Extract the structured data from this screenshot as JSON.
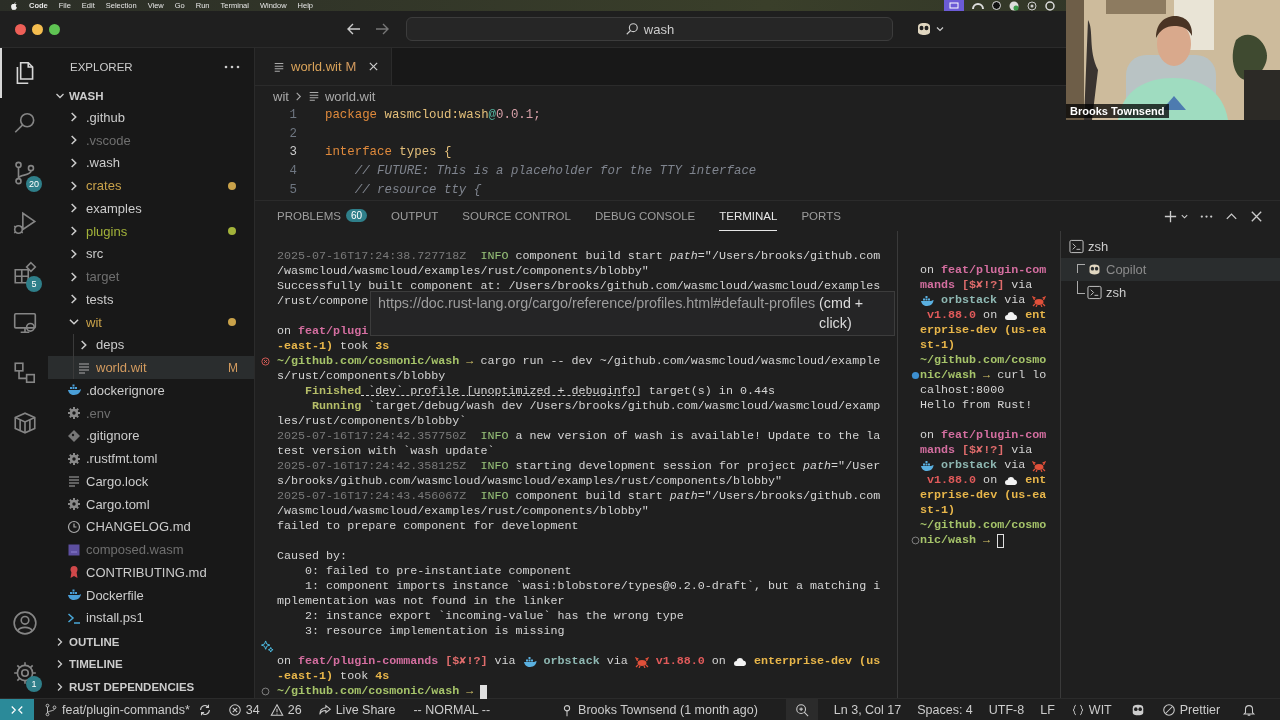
{
  "menu_bar": {
    "app": "Code",
    "items": [
      "File",
      "Edit",
      "Selection",
      "View",
      "Go",
      "Run",
      "Terminal",
      "Window",
      "Help"
    ]
  },
  "title_bar": {
    "search": {
      "value": "wash"
    }
  },
  "activity_bar": {
    "items": [
      {
        "kind": "explorer",
        "selected": true
      },
      {
        "kind": "search",
        "selected": false
      },
      {
        "kind": "source-control",
        "selected": false,
        "badge": "20"
      },
      {
        "kind": "run-debug",
        "selected": false
      },
      {
        "kind": "extensions",
        "selected": false,
        "badge": "5"
      },
      {
        "kind": "remote",
        "selected": false
      },
      {
        "kind": "graph",
        "selected": false
      },
      {
        "kind": "containers",
        "selected": false
      }
    ],
    "bottom": [
      {
        "kind": "account"
      },
      {
        "kind": "settings",
        "badge": "1"
      }
    ]
  },
  "explorer": {
    "title": "EXPLORER",
    "root": {
      "label": "WASH",
      "expanded": true,
      "children": [
        {
          "label": ".github",
          "kind": "folder",
          "expanded": false,
          "color": "#cccccc",
          "dot": false,
          "selected": false
        },
        {
          "label": ".vscode",
          "kind": "folder",
          "expanded": false,
          "color": "#6f6f6f",
          "dot": false,
          "selected": false
        },
        {
          "label": ".wash",
          "kind": "folder",
          "expanded": false,
          "color": "#cccccc",
          "dot": false,
          "selected": false
        },
        {
          "label": "crates",
          "kind": "folder",
          "expanded": false,
          "color": "#c9a24a",
          "dot": true,
          "selected": false
        },
        {
          "label": "examples",
          "kind": "folder",
          "expanded": false,
          "color": "#cccccc",
          "dot": false,
          "selected": false
        },
        {
          "label": "plugins",
          "kind": "folder",
          "expanded": false,
          "color": "#a3b33a",
          "dot": true,
          "selected": false
        },
        {
          "label": "src",
          "kind": "folder",
          "expanded": false,
          "color": "#cccccc",
          "dot": false,
          "selected": false
        },
        {
          "label": "target",
          "kind": "folder",
          "expanded": false,
          "color": "#6f6f6f",
          "dot": false,
          "selected": false
        },
        {
          "label": "tests",
          "kind": "folder",
          "expanded": false,
          "color": "#cccccc",
          "dot": false,
          "selected": false
        },
        {
          "label": "wit",
          "kind": "folder",
          "expanded": true,
          "color": "#c9a24a",
          "dot": true,
          "selected": false,
          "children": [
            {
              "label": "deps",
              "kind": "folder",
              "expanded": false,
              "color": "#cccccc",
              "dot": false,
              "selected": false
            },
            {
              "label": "world.wit",
              "kind": "text-file",
              "color": "#d39b5f",
              "dot": false,
              "badge": "M",
              "selected": true
            }
          ]
        },
        {
          "label": ".dockerignore",
          "kind": "docker-file",
          "color": "#cccccc",
          "dot": false,
          "selected": false
        },
        {
          "label": ".env",
          "kind": "config-file",
          "color": "#6f6f6f",
          "dot": false,
          "selected": false
        },
        {
          "label": ".gitignore",
          "kind": "git-file",
          "color": "#cccccc",
          "dot": false,
          "selected": false
        },
        {
          "label": ".rustfmt.toml",
          "kind": "config-file",
          "color": "#cccccc",
          "dot": false,
          "selected": false
        },
        {
          "label": "Cargo.lock",
          "kind": "text-file",
          "color": "#cccccc",
          "dot": false,
          "selected": false
        },
        {
          "label": "Cargo.toml",
          "kind": "config-file",
          "color": "#cccccc",
          "dot": false,
          "selected": false
        },
        {
          "label": "CHANGELOG.md",
          "kind": "changelog-file",
          "color": "#cccccc",
          "dot": false,
          "selected": false
        },
        {
          "label": "composed.wasm",
          "kind": "wasm-file",
          "color": "#6f6f6f",
          "dot": false,
          "selected": false
        },
        {
          "label": "CONTRIBUTING.md",
          "kind": "contributing-file",
          "color": "#cccccc",
          "dot": false,
          "selected": false
        },
        {
          "label": "Dockerfile",
          "kind": "docker-file",
          "color": "#cccccc",
          "dot": false,
          "selected": false
        },
        {
          "label": "install.ps1",
          "kind": "shell-file",
          "color": "#cccccc",
          "dot": false,
          "selected": false
        }
      ]
    },
    "sections": [
      {
        "label": "OUTLINE",
        "expanded": false
      },
      {
        "label": "TIMELINE",
        "expanded": false
      },
      {
        "label": "RUST DEPENDENCIES",
        "expanded": false
      }
    ]
  },
  "editor": {
    "tabs": [
      {
        "label": "world.wit",
        "badge": "M",
        "selected": true
      }
    ],
    "breadcrumb": [
      "wit",
      "world.wit"
    ],
    "lines": [
      {
        "number": "1",
        "current": false,
        "segments": [
          {
            "kind": "keyword",
            "text": "package "
          },
          {
            "kind": "name",
            "text": "wasmcloud:wash"
          },
          {
            "kind": "at",
            "text": "@"
          },
          {
            "kind": "number",
            "text": "0.0.1;"
          }
        ]
      },
      {
        "number": "2",
        "current": false
      },
      {
        "number": "3",
        "current": true,
        "segments": [
          {
            "kind": "keyword",
            "text": "interface "
          },
          {
            "kind": "name",
            "text": "types {"
          }
        ]
      },
      {
        "number": "4",
        "current": false,
        "segments": [
          {
            "kind": "comment",
            "text": "    // FUTURE: This is a placeholder for the TTY interface"
          }
        ]
      },
      {
        "number": "5",
        "current": false,
        "segments": [
          {
            "kind": "comment",
            "text": "    // resource tty {"
          }
        ]
      }
    ]
  },
  "panel": {
    "tabs": [
      {
        "label": "PROBLEMS",
        "badge": "60",
        "selected": false
      },
      {
        "label": "OUTPUT",
        "selected": false
      },
      {
        "label": "SOURCE CONTROL",
        "selected": false
      },
      {
        "label": "DEBUG CONSOLE",
        "selected": false
      },
      {
        "label": "TERMINAL",
        "selected": true
      },
      {
        "label": "PORTS",
        "selected": false
      }
    ]
  },
  "terminal": {
    "tooltip": {
      "link": "https://doc.rust-lang.org/cargo/reference/profiles.html#default-profiles",
      "hint": "(cmd + click)"
    },
    "panes": [
      {
        "focused": true,
        "lines": [
          {
            "kind": "output",
            "segments": [
              {
                "kind": "dim",
                "text": "2025-07-16T17:24:38.727718Z  "
              },
              {
                "kind": "info",
                "text": "INFO"
              },
              {
                "kind": "plain",
                "text": " component build start "
              },
              {
                "kind": "italic",
                "text": "path"
              },
              {
                "kind": "plain",
                "text": "=\"/Users/brooks/github.com"
              }
            ]
          },
          {
            "kind": "output",
            "segments": [
              {
                "kind": "plain",
                "text": "/wasmcloud/wasmcloud/examples/rust/components/blobby\""
              }
            ]
          },
          {
            "kind": "output",
            "segments": [
              {
                "kind": "plain",
                "text": "Successfully built component at: /Users/brooks/github.com/wasmcloud/wasmcloud/examples"
              }
            ]
          },
          {
            "kind": "output",
            "segments": [
              {
                "kind": "plain",
                "text": "/rust/compone"
              }
            ]
          },
          {
            "kind": "blank"
          },
          {
            "kind": "output",
            "segments": [
              {
                "kind": "plain",
                "text": "on "
              },
              {
                "kind": "branch",
                "text": "feat/plugi"
              }
            ]
          },
          {
            "kind": "output",
            "segments": [
              {
                "kind": "context",
                "text": "-east-1)"
              },
              {
                "kind": "plain",
                "text": " took "
              },
              {
                "kind": "context",
                "text": "3s"
              }
            ]
          },
          {
            "kind": "output",
            "decoration": {
              "kind": "error"
            },
            "segments": [
              {
                "kind": "path",
                "text": "~/github.com/cosmonic/wash"
              },
              {
                "kind": "arrow",
                "text": " → "
              },
              {
                "kind": "plain",
                "text": "cargo run -- dev ~/github.com/wasmcloud/wasmcloud/example"
              }
            ]
          },
          {
            "kind": "output",
            "segments": [
              {
                "kind": "plain",
                "text": "s/rust/components/blobby"
              }
            ]
          },
          {
            "kind": "output",
            "segments": [
              {
                "kind": "cargo",
                "text": "    Finished"
              },
              {
                "kind": "link",
                "text": " `dev` profile [unoptimized + debuginfo]"
              },
              {
                "kind": "plain",
                "text": " target(s) in 0.44s"
              }
            ]
          },
          {
            "kind": "output",
            "segments": [
              {
                "kind": "cargo",
                "text": "     Running"
              },
              {
                "kind": "plain",
                "text": " `target/debug/wash dev /Users/brooks/github.com/wasmcloud/wasmcloud/examp"
              }
            ]
          },
          {
            "kind": "output",
            "segments": [
              {
                "kind": "plain",
                "text": "les/rust/components/blobby`"
              }
            ]
          },
          {
            "kind": "output",
            "segments": [
              {
                "kind": "dim",
                "text": "2025-07-16T17:24:42.357750Z  "
              },
              {
                "kind": "info",
                "text": "INFO"
              },
              {
                "kind": "plain",
                "text": " a new version of wash is available! Update to the la"
              }
            ]
          },
          {
            "kind": "output",
            "segments": [
              {
                "kind": "plain",
                "text": "test version with `wash update`"
              }
            ]
          },
          {
            "kind": "output",
            "segments": [
              {
                "kind": "dim",
                "text": "2025-07-16T17:24:42.358125Z  "
              },
              {
                "kind": "info",
                "text": "INFO"
              },
              {
                "kind": "plain",
                "text": " starting development session for project "
              },
              {
                "kind": "italic",
                "text": "path"
              },
              {
                "kind": "plain",
                "text": "=\"/User"
              }
            ]
          },
          {
            "kind": "output",
            "segments": [
              {
                "kind": "plain",
                "text": "s/brooks/github.com/wasmcloud/wasmcloud/examples/rust/components/blobby\""
              }
            ]
          },
          {
            "kind": "output",
            "segments": [
              {
                "kind": "dim",
                "text": "2025-07-16T17:24:43.456067Z  "
              },
              {
                "kind": "info",
                "text": "INFO"
              },
              {
                "kind": "plain",
                "text": " component build start "
              },
              {
                "kind": "italic",
                "text": "path"
              },
              {
                "kind": "plain",
                "text": "=\"/Users/brooks/github.com"
              }
            ]
          },
          {
            "kind": "output",
            "segments": [
              {
                "kind": "plain",
                "text": "/wasmcloud/wasmcloud/examples/rust/components/blobby\""
              }
            ]
          },
          {
            "kind": "output",
            "segments": [
              {
                "kind": "plain",
                "text": "failed to prepare component for development"
              }
            ]
          },
          {
            "kind": "blank"
          },
          {
            "kind": "output",
            "segments": [
              {
                "kind": "plain",
                "text": "Caused by:"
              }
            ]
          },
          {
            "kind": "output",
            "segments": [
              {
                "kind": "plain",
                "text": "    0: failed to pre-instantiate component"
              }
            ]
          },
          {
            "kind": "output",
            "segments": [
              {
                "kind": "plain",
                "text": "    1: component imports instance `wasi:blobstore/types@0.2.0-draft`, but a matching i"
              }
            ]
          },
          {
            "kind": "output",
            "segments": [
              {
                "kind": "plain",
                "text": "mplementation was not found in the linker"
              }
            ]
          },
          {
            "kind": "output",
            "segments": [
              {
                "kind": "plain",
                "text": "    2: instance export `incoming-value` has the wrong type"
              }
            ]
          },
          {
            "kind": "output",
            "segments": [
              {
                "kind": "plain",
                "text": "    3: resource implementation is missing"
              }
            ]
          },
          {
            "kind": "blank",
            "decoration": {
              "kind": "sparkle"
            }
          },
          {
            "kind": "output",
            "segments": [
              {
                "kind": "plain",
                "text": "on "
              },
              {
                "kind": "branch",
                "text": "feat/plugin-commands"
              },
              {
                "kind": "status",
                "text": " [$✘!?]"
              },
              {
                "kind": "plain",
                "text": " via "
              },
              {
                "kind": "whale"
              },
              {
                "kind": "tool",
                "text": " orbstack"
              },
              {
                "kind": "plain",
                "text": " via "
              },
              {
                "kind": "crab"
              },
              {
                "kind": "version",
                "text": " v1.88.0"
              },
              {
                "kind": "plain",
                "text": " on "
              },
              {
                "kind": "cloud"
              },
              {
                "kind": "context",
                "text": " enterprise-dev (us"
              }
            ]
          },
          {
            "kind": "output",
            "segments": [
              {
                "kind": "context",
                "text": "-east-1)"
              },
              {
                "kind": "plain",
                "text": " took "
              },
              {
                "kind": "context",
                "text": "4s"
              }
            ]
          },
          {
            "kind": "output",
            "decoration": {
              "kind": "idle"
            },
            "segments": [
              {
                "kind": "path",
                "text": "~/github.com/cosmonic/wash"
              },
              {
                "kind": "arrow",
                "text": " → "
              },
              {
                "kind": "cursor"
              }
            ]
          }
        ]
      },
      {
        "focused": false,
        "lines": [
          {
            "kind": "output",
            "segments": [
              {
                "kind": "plain",
                "text": "on "
              },
              {
                "kind": "branch",
                "text": "feat/plugin-com"
              }
            ]
          },
          {
            "kind": "output",
            "segments": [
              {
                "kind": "branch",
                "text": "mands"
              },
              {
                "kind": "status",
                "text": " [$✘!?]"
              },
              {
                "kind": "plain",
                "text": " via"
              }
            ]
          },
          {
            "kind": "output",
            "segments": [
              {
                "kind": "whale"
              },
              {
                "kind": "tool",
                "text": " orbstack"
              },
              {
                "kind": "plain",
                "text": " via "
              },
              {
                "kind": "crab"
              }
            ]
          },
          {
            "kind": "output",
            "segments": [
              {
                "kind": "version",
                "text": " v1.88.0"
              },
              {
                "kind": "plain",
                "text": " on "
              },
              {
                "kind": "cloud"
              },
              {
                "kind": "context",
                "text": " ent"
              }
            ]
          },
          {
            "kind": "output",
            "segments": [
              {
                "kind": "context",
                "text": "erprise-dev (us-ea"
              }
            ]
          },
          {
            "kind": "output",
            "segments": [
              {
                "kind": "context",
                "text": "st-1)"
              }
            ]
          },
          {
            "kind": "output",
            "segments": [
              {
                "kind": "path",
                "text": "~/github.com/cosmo"
              }
            ]
          },
          {
            "kind": "output",
            "decoration": {
              "kind": "success"
            },
            "segments": [
              {
                "kind": "path",
                "text": "nic/wash"
              },
              {
                "kind": "arrow",
                "text": " → "
              },
              {
                "kind": "plain",
                "text": "curl lo"
              }
            ]
          },
          {
            "kind": "output",
            "segments": [
              {
                "kind": "plain",
                "text": "calhost:8000"
              }
            ]
          },
          {
            "kind": "output",
            "segments": [
              {
                "kind": "plain",
                "text": "Hello from Rust!"
              }
            ]
          },
          {
            "kind": "blank"
          },
          {
            "kind": "output",
            "segments": [
              {
                "kind": "plain",
                "text": "on "
              },
              {
                "kind": "branch",
                "text": "feat/plugin-com"
              }
            ]
          },
          {
            "kind": "output",
            "segments": [
              {
                "kind": "branch",
                "text": "mands"
              },
              {
                "kind": "status",
                "text": " [$✘!?]"
              },
              {
                "kind": "plain",
                "text": " via"
              }
            ]
          },
          {
            "kind": "output",
            "segments": [
              {
                "kind": "whale"
              },
              {
                "kind": "tool",
                "text": " orbstack"
              },
              {
                "kind": "plain",
                "text": " via "
              },
              {
                "kind": "crab"
              }
            ]
          },
          {
            "kind": "output",
            "segments": [
              {
                "kind": "version",
                "text": " v1.88.0"
              },
              {
                "kind": "plain",
                "text": " on "
              },
              {
                "kind": "cloud"
              },
              {
                "kind": "context",
                "text": " ent"
              }
            ]
          },
          {
            "kind": "output",
            "segments": [
              {
                "kind": "context",
                "text": "erprise-dev (us-ea"
              }
            ]
          },
          {
            "kind": "output",
            "segments": [
              {
                "kind": "context",
                "text": "st-1)"
              }
            ]
          },
          {
            "kind": "output",
            "segments": [
              {
                "kind": "path",
                "text": "~/github.com/cosmo"
              }
            ]
          },
          {
            "kind": "output",
            "decoration": {
              "kind": "idle"
            },
            "segments": [
              {
                "kind": "path",
                "text": "nic/wash"
              },
              {
                "kind": "arrow",
                "text": " → "
              },
              {
                "kind": "cursor"
              }
            ]
          }
        ]
      }
    ],
    "sessions": [
      {
        "label": "zsh",
        "kind": "shell",
        "selected": false,
        "children": [
          {
            "label": "Copilot",
            "kind": "copilot",
            "selected": true
          },
          {
            "label": "zsh",
            "kind": "shell",
            "selected": false
          }
        ]
      }
    ]
  },
  "status_bar": {
    "branch": "feat/plugin-commands*",
    "errors": "34",
    "warnings": "26",
    "live_share": "Live Share",
    "mode": "-- NORMAL --",
    "blame": "Brooks Townsend (1 month ago)",
    "position": "Ln 3, Col 17",
    "indent": "Spaces: 4",
    "encoding": "UTF-8",
    "eol": "LF",
    "language": "WIT",
    "formatter": "Prettier"
  },
  "video": {
    "kind": "picture",
    "name": "Brooks Townsend"
  }
}
